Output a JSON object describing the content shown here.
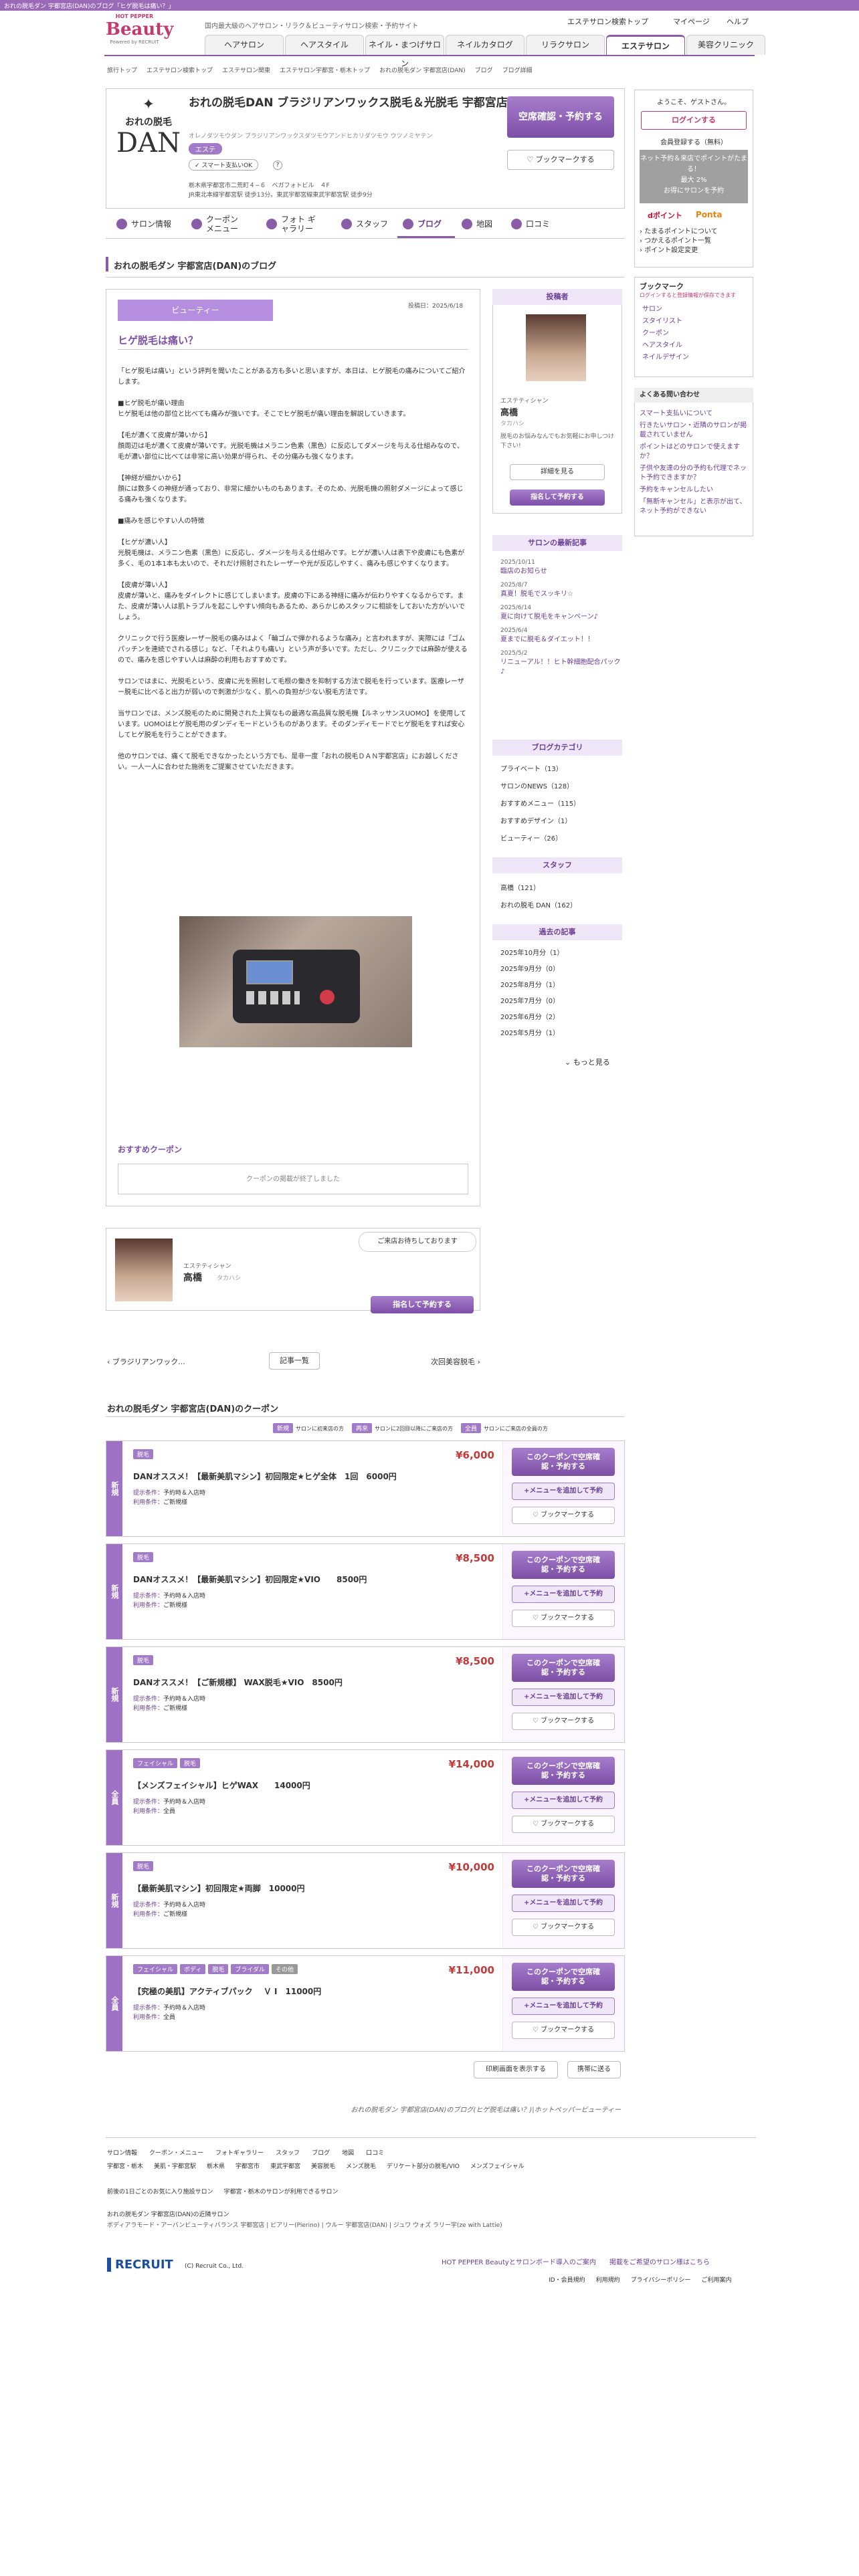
{
  "topbar": {
    "text": "おれの脱毛ダン 宇都宮店(DAN)のブログ「ヒゲ脱毛は痛い？」"
  },
  "header": {
    "logo_small": "HOT PEPPER",
    "logo_big": "Beauty",
    "powered": "Powered by RECRUIT",
    "tagline": "国内最大級のヘアサロン・リラク＆ビューティサロン検索・予約サイト",
    "links": [
      "エステサロン検索トップ",
      "マイページ",
      "ヘルプ"
    ],
    "tabs": [
      "ヘアサロン",
      "ヘアスタイル",
      "ネイル・まつげサロン",
      "ネイルカタログ",
      "リラクサロン",
      "エステサロン",
      "美容クリニック"
    ],
    "active_tab": "エステサロン"
  },
  "breadcrumb": [
    "旅行トップ",
    "エステサロン検索トップ",
    "エステサロン関東",
    "エステサロン宇都宮・栃木トップ",
    "おれの脱毛ダン 宇都宮店(DAN)",
    "ブログ",
    "ブログ詳細"
  ],
  "shop": {
    "logo_lines": [
      "おれの脱毛",
      "DAN"
    ],
    "name": "おれの脱毛DAN ブラジリアンワックス脱毛＆光脱毛 宇都宮店",
    "kana": "オレノダツモウダン ブラジリアンワックスダツモウアンドヒカリダツモウ ウツノミヤテン",
    "badge": "エステ",
    "coupon_badge": "クーポン有",
    "feature": "スマート支払いOK",
    "address": "栃木県宇都宮市二荒町４−６　ベガフォトビル　４F",
    "access": "JR東北本線宇都宮駅 徒歩13分。東武宇都宮線東武宇都宮駅 徒歩9分",
    "reserve_btn": "空席確認・予約する",
    "bookmark_btn": "ブックマークする"
  },
  "shop_tabs": [
    "サロン情報",
    "クーポン メニュー",
    "フォト ギャラリー",
    "スタッフ",
    "ブログ",
    "地図",
    "口コミ"
  ],
  "blog_header": "おれの脱毛ダン 宇都宮店(DAN)のブログ",
  "post": {
    "category": "ビューティー",
    "date": "投稿日：2025/6/18",
    "title": "ヒゲ脱毛は痛い？",
    "paragraphs": [
      "「ヒゲ脱毛は痛い」という評判を聞いたことがある方も多いと思いますが、本日は、ヒゲ脱毛の痛みについてご紹介します。",
      "■ヒゲ脱毛が痛い理由\nヒゲ脱毛は他の部位と比べても痛みが強いです。そこでヒゲ脱毛が痛い理由を解説していきます。",
      "【毛が濃くて皮膚が薄いから】\n顔周辺は毛が濃くて皮膚が薄いです。光脱毛機はメラニン色素（黒色）に反応してダメージを与える仕組みなので、毛が濃い部位に比べては非常に高い効果が得られ、その分痛みも強くなります。",
      "【神経が細かいから】\n顔には数多くの神経が通っており、非常に細かいものもあります。そのため、光脱毛機の照射ダメージによって感じる痛みも強くなります。",
      "■痛みを感じやすい人の特徴",
      "【ヒゲが濃い人】\n光脱毛機は、メラニン色素（黒色）に反応し、ダメージを与える仕組みです。ヒゲが濃い人は表下や皮膚にも色素が多く、毛の1本1本も太いので、それだけ照射されたレーザーや光が反応しやすく、痛みも感じやすくなります。",
      "【皮膚が薄い人】\n皮膚が薄いと、痛みをダイレクトに感じてしまいます。皮膚の下にある神経に痛みが伝わりやすくなるからです。また、皮膚が薄い人は肌トラブルを起こしやすい傾向もあるため、あらかじめスタッフに相談をしておいた方がいいでしょう。",
      "クリニックで行う医療レーザー脱毛の痛みはよく「輪ゴムで弾かれるような痛み」と言われますが、実際には「ゴムパッチンを連続でされる感じ」など、「それよりも痛い」という声が多いです。ただし、クリニックでは麻酔が使えるので、痛みを感じやすい人は麻酔の利用もおすすめです。",
      "サロンではまに、光脱毛という、皮膚に光を照射して毛根の働きを抑制する方法で脱毛を行っています。医療レーザー脱毛に比べると出力が弱いので刺激が少なく、肌への負担が少ない脱毛方法です。",
      "当サロンでは、メンズ脱毛のために開発された上質なもの最適な高品質な脱毛機【ルネッサンスUOMO】を使用しています。UOMOはヒゲ脱毛用のダンディモードというものがあります。そのダンディモードでヒゲ脱毛をすれば安心してヒゲ脱毛を行うことができます。",
      "他のサロンでは、痛くて脱毛できなかったという方でも、是非一度「おれの脱毛ＤＡＮ宇都宮店」にお越しください。一人一人に合わせた施術をご提案させていただきます。"
    ],
    "recommended_coupon_title": "おすすめクーポン",
    "coupon_ended": "クーポンの掲載が終了しました"
  },
  "author_box": {
    "role": "エステティシャン",
    "name": "高橋",
    "kana": "タカハシ",
    "bubble": "ご来店お待ちしております",
    "button": "指名して予約する"
  },
  "post_nav": {
    "prev": "ブラジリアンワック...",
    "list": "記事一覧",
    "next": "次回美容脱毛"
  },
  "sidebar": {
    "poster_label": "投稿者",
    "poster_role": "エステティシャン",
    "poster_name": "高橋",
    "poster_kana": "タカハシ",
    "poster_note": "脱毛のお悩みなんでもお気軽にお申しつけ下さい!",
    "detail_btn": "詳細を見る",
    "nominate_btn": "指名して予約する",
    "recent_title": "サロンの最新記事",
    "recent": [
      {
        "date": "2025/10/11",
        "title": "臨店のお知らせ"
      },
      {
        "date": "2025/8/7",
        "title": "真夏！脱毛でスッキリ☆"
      },
      {
        "date": "2025/6/14",
        "title": "夏に向けて脱毛をキャンペーン♪"
      },
      {
        "date": "2025/6/4",
        "title": "夏までに脱毛＆ダイエット！！"
      },
      {
        "date": "2025/5/2",
        "title": "リニューアル！！ヒト幹細胞配合パック♪"
      }
    ],
    "category_title": "ブログカテゴリ",
    "categories": [
      "プライベート（13）",
      "サロンのNEWS（128）",
      "おすすめメニュー（115）",
      "おすすめデザイン（1）",
      "ビューティー（26）"
    ],
    "staff_title": "スタッフ",
    "staff": [
      "高橋（121）",
      "おれの脱毛 DAN（162）"
    ],
    "archive_title": "過去の記事",
    "archive": [
      "2025年10月分（1）",
      "2025年9月分（0）",
      "2025年8月分（1）",
      "2025年7月分（0）",
      "2025年6月分（2）",
      "2025年5月分（1）"
    ],
    "more": "もっと見る"
  },
  "right": {
    "welcome": "ようこそ、ゲストさん。",
    "login": "ログインする",
    "register": "会員登録する（無料）",
    "point_banner": "ネット予約＆来店でポイントがたまる！\n最大 2%\nお得にサロンを予約",
    "dpoint": "dポイント",
    "ponta": "Ponta",
    "point_links": [
      "たまるポイントについて",
      "つかえるポイント一覧",
      "ポイント設定変更"
    ],
    "bookmark_title": "ブックマーク",
    "bookmark_note": "ログインすると登録情報が保存できます",
    "bookmark_links": [
      "サロン",
      "スタイリスト",
      "クーポン",
      "ヘアスタイル",
      "ネイルデザイン"
    ],
    "faq_title": "よくある問い合わせ",
    "faq": [
      "スマート支払いについて",
      "行きたいサロン・近隣のサロンが掲載されていません",
      "ポイントはどのサロンで使えますか？",
      "子供や友達の分の予約も代理でネット予約できますか？",
      "予約をキャンセルしたい",
      "「無断キャンセル」と表示が出て、ネット予約ができない"
    ]
  },
  "coupons": {
    "title": "おれの脱毛ダン 宇都宮店(DAN)のクーポン",
    "legend": [
      {
        "tag": "新規",
        "text": "サロンに初来店の方"
      },
      {
        "tag": "再来",
        "text": "サロンに2回目以降にご来店の方"
      },
      {
        "tag": "全員",
        "text": "サロンにご来店の全員の方"
      }
    ],
    "present_label": "提示条件：",
    "use_label": "利用条件：",
    "btn_reserve": "このクーポンで空席確認・予約する",
    "btn_add": "+メニューを追加して予約",
    "btn_bookmark": "ブックマークする",
    "items": [
      {
        "side": "新規",
        "tags": [
          "脱毛"
        ],
        "price": "¥6,000",
        "name": "DANオススメ！【最新美肌マシン】初回限定★ヒゲ全体　1回　6000円",
        "present": "予約時＆入店時",
        "use": "ご新規様"
      },
      {
        "side": "新規",
        "tags": [
          "脱毛"
        ],
        "price": "¥8,500",
        "name": "DANオススメ！【最新美肌マシン】初回限定★VIO　　8500円",
        "present": "予約時＆入店時",
        "use": "ご新規様"
      },
      {
        "side": "新規",
        "tags": [
          "脱毛"
        ],
        "price": "¥8,500",
        "name": "DANオススメ！【ご新規様】 WAX脱毛★VIO　8500円",
        "present": "予約時＆入店時",
        "use": "ご新規様"
      },
      {
        "side": "全員",
        "tags": [
          "フェイシャル",
          "脱毛"
        ],
        "price": "¥14,000",
        "name": "【メンズフェイシャル】ヒゲWAX　　14000円",
        "present": "予約時＆入店時",
        "use": "全員"
      },
      {
        "side": "新規",
        "tags": [
          "脱毛"
        ],
        "price": "¥10,000",
        "name": "【最新美肌マシン】初回限定★両脚　10000円",
        "present": "予約時＆入店時",
        "use": "ご新規様"
      },
      {
        "side": "全員",
        "tags": [
          "フェイシャル",
          "ボディ",
          "脱毛",
          "ブライダル",
          "その他"
        ],
        "price": "¥11,000",
        "name": "【究極の美肌】アクティブパック　 Ｖ I　11000円",
        "present": "予約時＆入店時",
        "use": "全員"
      }
    ]
  },
  "bottom_buttons": [
    "印刷画面を表示する",
    "携帯に送る"
  ],
  "breadcrumb_footer": "おれの脱毛ダン 宇都宮店(DAN)のブログ(ヒゲ脱毛は痛い？)|ホットペッパービューティー",
  "footer": {
    "links1": [
      "サロン情報",
      "クーポン・メニュー",
      "フォトギャラリー",
      "スタッフ",
      "ブログ",
      "地図",
      "口コミ"
    ],
    "links2": [
      "宇都宮・栃木",
      "美肌・宇都宮駅",
      "栃木県",
      "宇都宮市",
      "東武宇都宮",
      "美容脱毛",
      "メンズ脱毛",
      "デリケート部分の脱毛/VIO",
      "メンズフェイシャル"
    ],
    "links3": [
      "前後の1日ごとのお気に入り施設サロン",
      "宇都宮・栃木のサロンが利用できるサロン"
    ],
    "related_title": "おれの脱毛ダン 宇都宮店(DAN)の近隣サロン",
    "related": "ボディアラモード・アーバンビューティバランス 宇都宮店 | ピアリー(Pierino) | ウルー 宇都宮店(DAN) | ジュワ ウォズ ラリー宇(ze with Lattie)",
    "recruit": "RECRUIT",
    "copyright": "(C) Recruit Co., Ltd.",
    "right_links": [
      "HOT PEPPER Beautyとサロンボード導入のご案内",
      "掲載をご希望のサロン様はこちら"
    ],
    "right_links2": [
      "ID・会員規約",
      "利用規約",
      "プライバシーポリシー",
      "ご利用案内"
    ]
  }
}
